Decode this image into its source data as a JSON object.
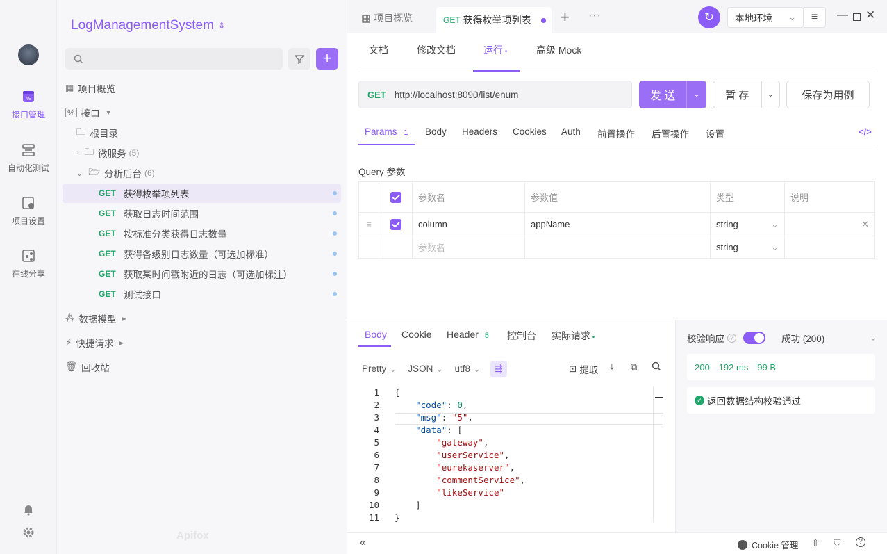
{
  "sidebar_nav": [
    {
      "label": "接口管理",
      "icon": "api-icon",
      "active": true
    },
    {
      "label": "自动化测试",
      "icon": "automation-icon"
    },
    {
      "label": "项目设置",
      "icon": "settings-doc-icon"
    },
    {
      "label": "在线分享",
      "icon": "share-icon"
    }
  ],
  "project": {
    "name": "LogManagementSystem",
    "switch_icon": "up-down-chevron-icon"
  },
  "tree": {
    "overview": "项目概览",
    "api": "接口",
    "root": "根目录",
    "folders": [
      {
        "name": "微服务",
        "count": "(5)"
      },
      {
        "name": "分析后台",
        "count": "(6)"
      }
    ],
    "endpoints": [
      {
        "method": "GET",
        "name": "获得枚举项列表"
      },
      {
        "method": "GET",
        "name": "获取日志时间范围"
      },
      {
        "method": "GET",
        "name": "按标准分类获得日志数量"
      },
      {
        "method": "GET",
        "name": "获得各级别日志数量（可选加标准）"
      },
      {
        "method": "GET",
        "name": "获取某时间戳附近的日志（可选加标注）"
      },
      {
        "method": "GET",
        "name": "测试接口"
      }
    ],
    "data_model": "数据模型",
    "quick_request": "快捷请求",
    "trash": "回收站"
  },
  "topbar": {
    "tab_overview": "项目概览",
    "tab_active_method": "GET",
    "tab_active": "获得枚举项列表",
    "env": "本地环境"
  },
  "subtabs": [
    "文档",
    "修改文档",
    "运行",
    "高级 Mock"
  ],
  "request": {
    "method": "GET",
    "url": "http://localhost:8090/list/enum",
    "send": "发 送",
    "save_temp": "暂 存",
    "save_case": "保存为用例"
  },
  "param_tabs": [
    {
      "label": "Params",
      "badge": "1"
    },
    {
      "label": "Body"
    },
    {
      "label": "Headers"
    },
    {
      "label": "Cookies"
    },
    {
      "label": "Auth"
    },
    {
      "label": "前置操作"
    },
    {
      "label": "后置操作"
    },
    {
      "label": "设置"
    }
  ],
  "query": {
    "title": "Query 参数",
    "headers": [
      "参数名",
      "参数值",
      "类型",
      "说明"
    ],
    "rows": [
      {
        "name": "column",
        "value": "appName",
        "type": "string",
        "desc": ""
      }
    ],
    "empty_placeholder": "参数名",
    "empty_type": "string"
  },
  "response_tabs": [
    {
      "label": "Body"
    },
    {
      "label": "Cookie"
    },
    {
      "label": "Header",
      "badge": "5"
    },
    {
      "label": "控制台"
    },
    {
      "label": "实际请求"
    }
  ],
  "response_format": {
    "view": "Pretty",
    "lang": "JSON",
    "encoding": "utf8",
    "extract": "提取"
  },
  "response_lines": [
    "{",
    "    \"code\": 0,",
    "    \"msg\": \"5\",",
    "    \"data\": [",
    "        \"gateway\",",
    "        \"userService\",",
    "        \"eurekaserver\",",
    "        \"commentService\",",
    "        \"likeService\"",
    "    ]",
    "}"
  ],
  "validation": {
    "label": "校验响应",
    "result": "成功 (200)",
    "status_code": "200",
    "time": "192 ms",
    "size": "99 B",
    "message": "返回数据结构校验通过"
  },
  "bottom": {
    "cookie": "Cookie 管理",
    "watermark": "Apifox"
  },
  "colors": {
    "accent": "#8b5cf6",
    "get": "#23a66b"
  }
}
